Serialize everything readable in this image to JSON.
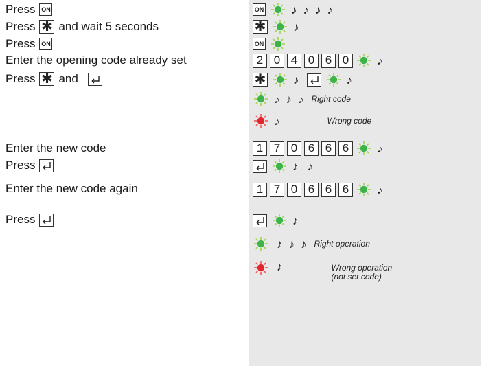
{
  "colors": {
    "panel": "#e8e8e8",
    "led_green": "#3cb44a",
    "led_green_rays": "#9ed54a",
    "led_red": "#e3262e",
    "led_red_rays": "#f15a5a"
  },
  "keys": {
    "on": "ON",
    "star": "✱",
    "enter": "enter-icon"
  },
  "steps": [
    {
      "before": "Press",
      "key": "on"
    },
    {
      "before": "Press",
      "key": "star",
      "after": "and wait 5 seconds"
    },
    {
      "before": "Press",
      "key": "on"
    },
    {
      "text": "Enter the opening code already set"
    },
    {
      "before": "Press",
      "key": "star",
      "middle": "and",
      "key2": "enter"
    },
    {
      "text": "Enter the new code"
    },
    {
      "before": "Press",
      "key": "enter"
    },
    {
      "text": "Enter the new code again"
    },
    {
      "before": "Press",
      "key": "enter"
    }
  ],
  "opening_code": [
    "2",
    "0",
    "4",
    "0",
    "6",
    "0"
  ],
  "new_code": [
    "1",
    "7",
    "0",
    "6",
    "6",
    "6"
  ],
  "led_letters": {
    "green": "V",
    "red": "R"
  },
  "note_glyph": "♪",
  "results": {
    "right_code": "Right code",
    "wrong_code": "Wrong code",
    "right_operation": "Right operation",
    "wrong_operation_1": "Wrong operation",
    "wrong_operation_2": "(not set code)"
  }
}
